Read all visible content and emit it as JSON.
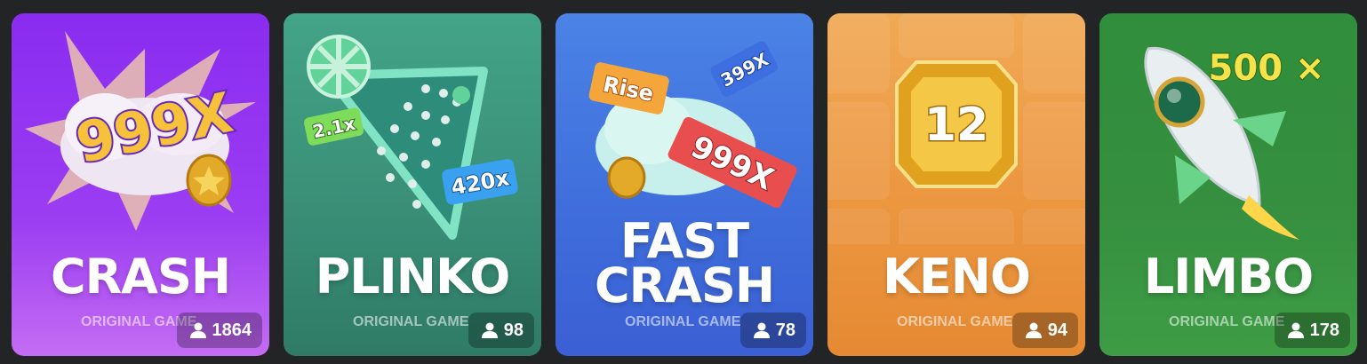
{
  "games": [
    {
      "title_lines": [
        "CRASH"
      ],
      "subtitle": "ORIGINAL GAME",
      "players": "1864",
      "art_text": "999X",
      "colors": {
        "top": "#8a2cf0",
        "bottom": "#c46cf3"
      }
    },
    {
      "title_lines": [
        "PLINKO"
      ],
      "subtitle": "ORIGINAL GAME",
      "players": "98",
      "art_text": [
        "2.1x",
        "420x"
      ],
      "colors": {
        "top": "#3a9a80",
        "bottom": "#2f7b66"
      }
    },
    {
      "title_lines": [
        "FAST",
        "CRASH"
      ],
      "subtitle": "ORIGINAL GAME",
      "players": "78",
      "art_text": [
        "Rise",
        "399X",
        "999X"
      ],
      "colors": {
        "top": "#4b83e6",
        "bottom": "#3b5fd4"
      }
    },
    {
      "title_lines": [
        "KENO"
      ],
      "subtitle": "ORIGINAL GAME",
      "players": "94",
      "art_text": [
        "12"
      ],
      "colors": {
        "top": "#f0a14d",
        "bottom": "#e58a33"
      }
    },
    {
      "title_lines": [
        "LIMBO"
      ],
      "subtitle": "ORIGINAL GAME",
      "players": "178",
      "art_text": [
        "500 ×"
      ],
      "colors": {
        "top": "#2f8e3c",
        "bottom": "#3e9c45"
      }
    }
  ]
}
